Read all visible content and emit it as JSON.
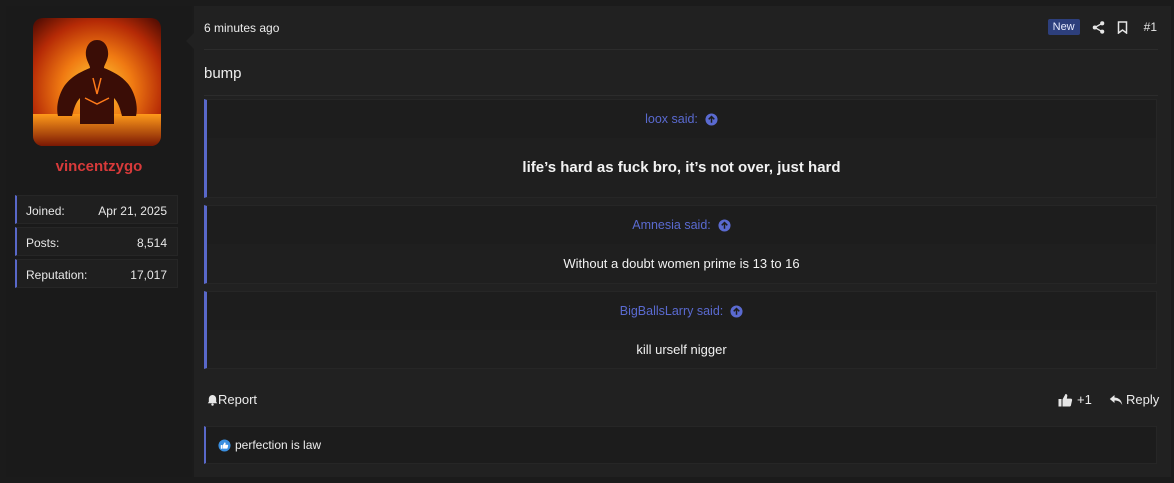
{
  "user": {
    "name": "vincentzygo",
    "stats": [
      {
        "label": "Joined:",
        "value": "Apr 21, 2025"
      },
      {
        "label": "Posts:",
        "value": "8,514"
      },
      {
        "label": "Reputation:",
        "value": "17,017"
      }
    ]
  },
  "post": {
    "time": "6 minutes ago",
    "badge": "New",
    "number": "#1",
    "text": "bump"
  },
  "quotes": [
    {
      "author": "loox said:",
      "text": "life’s hard as fuck bro, it’s not over, just hard"
    },
    {
      "author": "Amnesia said:",
      "text": "Without a doubt women prime is 13 to 16"
    },
    {
      "author": "BigBallsLarry said:",
      "text": "kill urself nigger"
    }
  ],
  "footer": {
    "report": "Report",
    "reaction_count": "+1",
    "reply": "Reply"
  },
  "signature": "perfection is law",
  "colors": {
    "accent": "#5968c9",
    "username": "#d83a3a",
    "badge_bg": "#2d3f7c"
  }
}
